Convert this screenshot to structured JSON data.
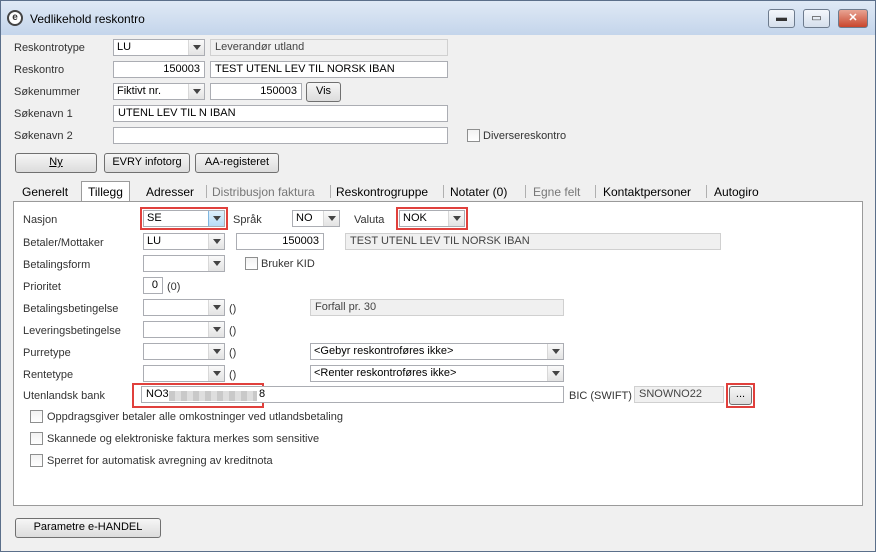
{
  "window": {
    "title": "Vedlikehold reskontro",
    "minimize": "▬",
    "restore": "▭",
    "close": "✕"
  },
  "header": {
    "reskontrotype_label": "Reskontrotype",
    "reskontrotype_value": "LU",
    "reskontrotype_desc": "Leverandør utland",
    "reskontro_label": "Reskontro",
    "reskontro_number": "150003",
    "reskontro_name": "TEST UTENL LEV TIL NORSK IBAN",
    "sokenummer_label": "Søkenummer",
    "sokenummer_type": "Fiktivt nr.",
    "sokenummer_value": "150003",
    "vis_button": "Vis",
    "sokenavn1_label": "Søkenavn 1",
    "sokenavn1_value": "UTENL LEV TIL N IBAN",
    "sokenavn2_label": "Søkenavn 2",
    "sokenavn2_value": "",
    "diverse_label": "Diversereskontro"
  },
  "actions": {
    "ny": "Ny",
    "evry": "EVRY infotorg",
    "aa": "AA-registeret"
  },
  "tabs": [
    {
      "label": "Generelt"
    },
    {
      "label": "Tillegg"
    },
    {
      "label": "Adresser"
    },
    {
      "label": "Distribusjon faktura"
    },
    {
      "label": "Reskontrogruppe"
    },
    {
      "label": "Notater (0)"
    },
    {
      "label": "Egne felt"
    },
    {
      "label": "Kontaktpersoner"
    },
    {
      "label": "Autogiro"
    }
  ],
  "tillegg": {
    "nasjon_label": "Nasjon",
    "nasjon_value": "SE",
    "sprak_label": "Språk",
    "sprak_value": "NO",
    "valuta_label": "Valuta",
    "valuta_value": "NOK",
    "betaler_label": "Betaler/Mottaker",
    "betaler_type": "LU",
    "betaler_number": "150003",
    "betaler_name": "TEST UTENL LEV TIL NORSK IBAN",
    "betalingsform_label": "Betalingsform",
    "bruker_kid_label": "Bruker KID",
    "prioritet_label": "Prioritet",
    "prioritet_value": "0",
    "prioritet_paren": "(0)",
    "betalingsbet_label": "Betalingsbetingelse",
    "betalingsbet_paren": "()",
    "betalingsbet_desc": "Forfall pr. 30",
    "leveringsbet_label": "Leveringsbetingelse",
    "leveringsbet_paren": "()",
    "purretype_label": "Purretype",
    "purretype_paren": "()",
    "purretype_combo": "<Gebyr reskontroføres ikke>",
    "rentetype_label": "Rentetype",
    "rentetype_paren": "()",
    "rentetype_combo": "<Renter reskontroføres ikke>",
    "bank_label": "Utenlandsk bank",
    "bank_prefix": "NO3",
    "bank_suffix": "8",
    "bic_label": "BIC (SWIFT)",
    "bic_value": "SNOWNO22",
    "browse_button": "...",
    "opt1": "Oppdragsgiver betaler alle omkostninger ved utlandsbetaling",
    "opt2": "Skannede og elektroniske faktura merkes som sensitive",
    "opt3": "Sperret for automatisk avregning av kreditnota"
  },
  "footer": {
    "parametre": "Parametre e-HANDEL"
  }
}
